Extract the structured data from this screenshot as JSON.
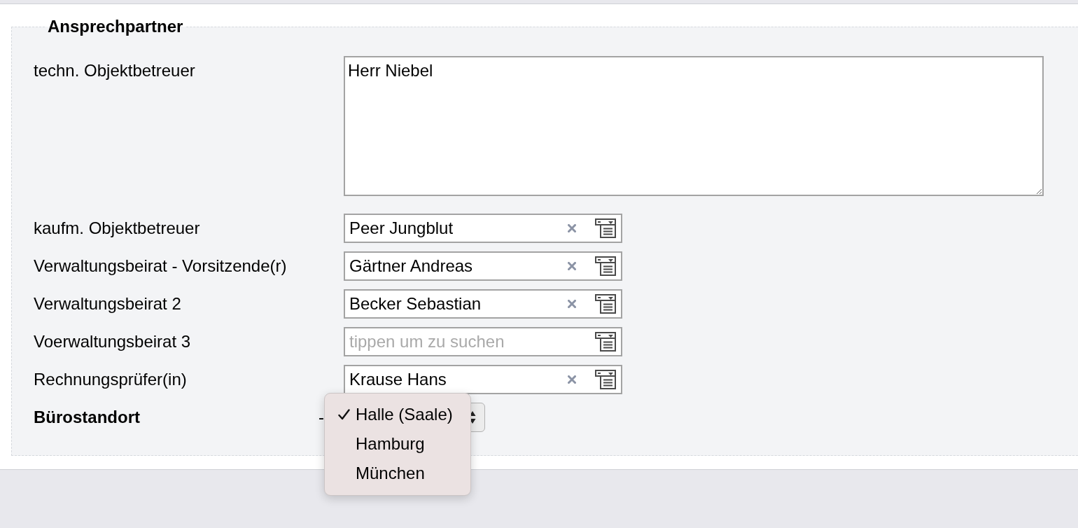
{
  "section": {
    "title": "Ansprechpartner"
  },
  "fields": [
    {
      "kind": "textarea",
      "label": "techn. Objektbetreuer",
      "value": "Herr Niebel"
    },
    {
      "kind": "lookup",
      "label": "kaufm. Objektbetreuer",
      "value": "Peer Jungblut"
    },
    {
      "kind": "lookup",
      "label": "Verwaltungsbeirat - Vorsitzende(r)",
      "value": "Gärtner Andreas"
    },
    {
      "kind": "lookup",
      "label": "Verwaltungsbeirat 2",
      "value": "Becker Sebastian"
    },
    {
      "kind": "lookup",
      "label": "Voerwaltungsbeirat 3",
      "placeholder": "tippen um zu suchen"
    },
    {
      "kind": "lookup",
      "label": "Rechnungsprüfer(in)",
      "value": "Krause Hans"
    }
  ],
  "location": {
    "label": "Bürostandort",
    "lead_text": "-",
    "options": [
      {
        "label": "Halle (Saale)",
        "selected": true
      },
      {
        "label": "Hamburg",
        "selected": false
      },
      {
        "label": "München",
        "selected": false
      }
    ]
  }
}
